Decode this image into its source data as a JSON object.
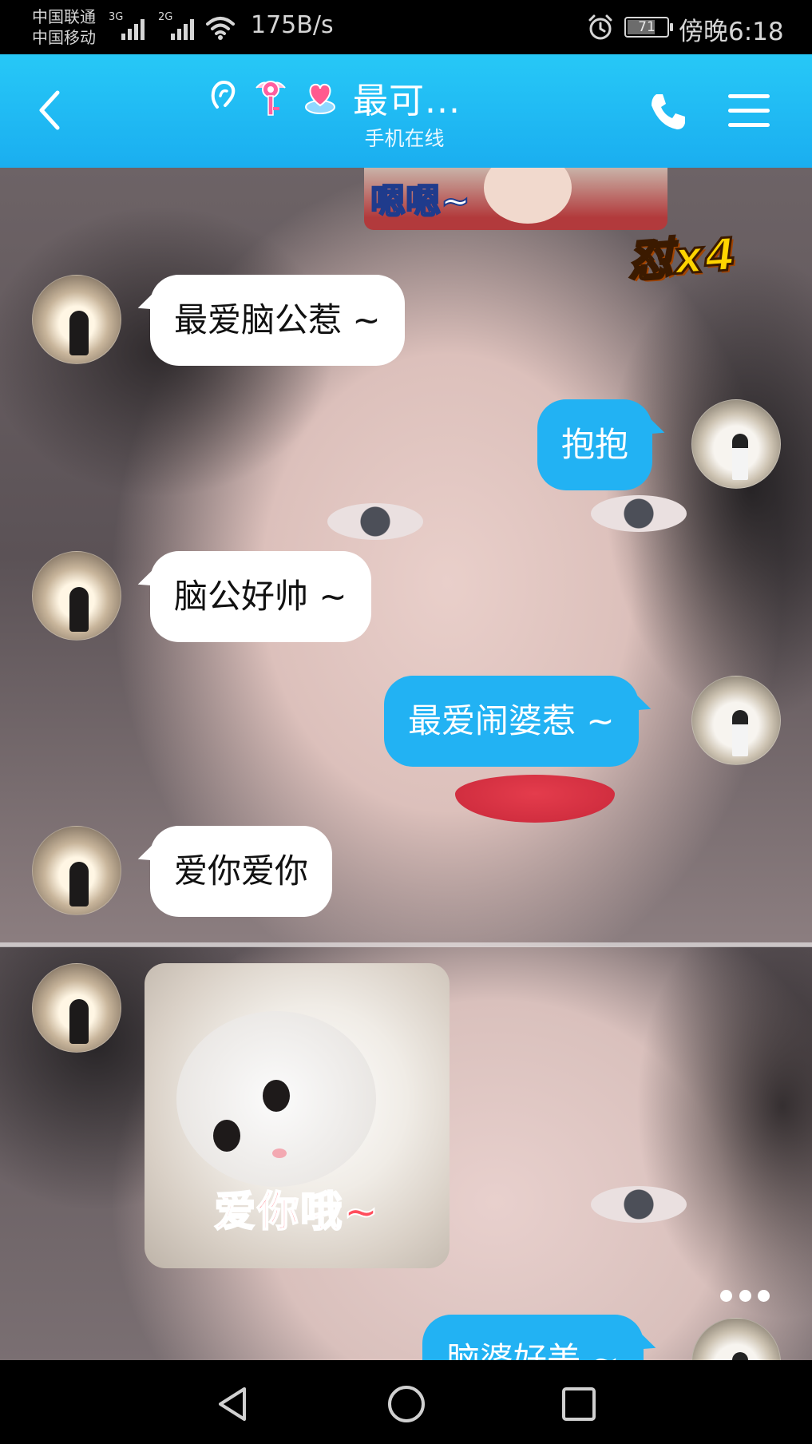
{
  "status_bar": {
    "carrier_1": "中国联通",
    "carrier_2": "中国移动",
    "sim1_network": "3G",
    "sim2_network": "2G",
    "net_speed": "175B/s",
    "battery_level": "71",
    "battery_fraction": 0.71,
    "time": "傍晚6:18"
  },
  "header": {
    "title": "最可...",
    "subtitle": "手机在线",
    "icons": [
      "ear-icon",
      "key-badge-icon",
      "heart-ring-icon"
    ],
    "accent_color": "#1aaef0"
  },
  "chat": {
    "top_sticker_text": "嗯嗯~",
    "streak_badge": "怼x4",
    "messages": [
      {
        "side": "in",
        "text": "最爱脑公惹 ~"
      },
      {
        "side": "out",
        "text": "抱抱"
      },
      {
        "side": "in",
        "text": "脑公好帅 ~"
      },
      {
        "side": "out",
        "text": "最爱闹婆惹 ~"
      },
      {
        "side": "in",
        "text": "爱你爱你"
      },
      {
        "side": "in",
        "type": "sticker",
        "text": "爱你哦~"
      },
      {
        "side": "out",
        "text": "脑婆好美 ~"
      }
    ],
    "outgoing_bubble_color": "#22b2f3",
    "incoming_bubble_color": "#ffffff"
  },
  "nav_bar": {
    "icons": [
      "back-triangle-icon",
      "home-circle-icon",
      "recents-square-icon"
    ]
  }
}
